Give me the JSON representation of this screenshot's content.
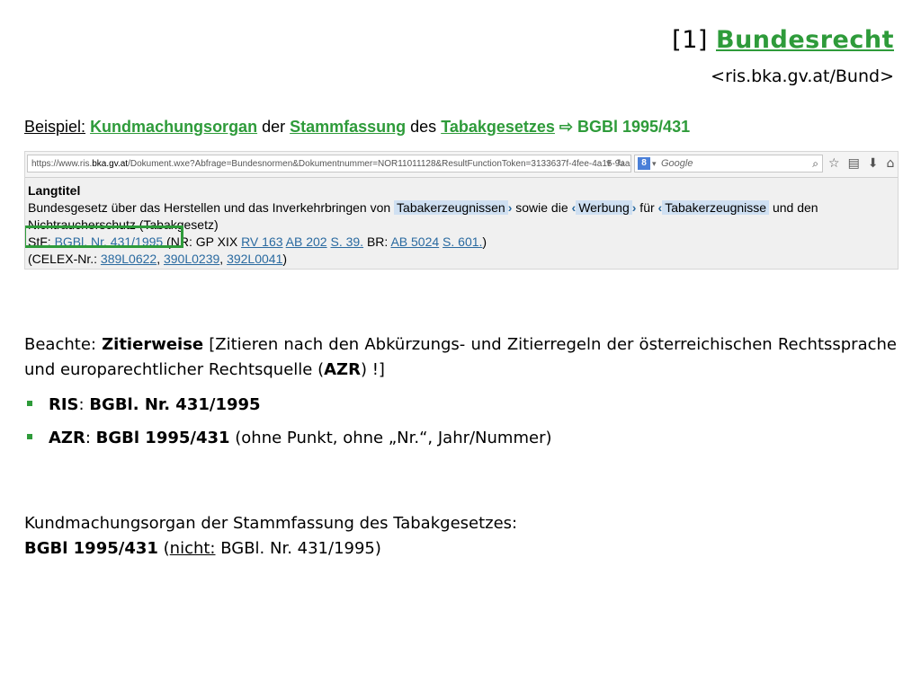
{
  "header": {
    "prefix": "[1] ",
    "title_link": "Bundesrecht",
    "subtitle": "<ris.bka.gv.at/Bund>"
  },
  "example": {
    "label": "Beispiel:",
    "w1": "Kundmachungsorgan",
    "w2": " der ",
    "w3": "Stammfassung",
    "w4": " des ",
    "w5": "Tabakgesetzes",
    "arrow": " ⇨ ",
    "citation": "BGBl 1995/431"
  },
  "browser": {
    "url_prefix": "https://www.ris.",
    "url_domain": "bka.gv.at",
    "url_rest": "/Dokument.wxe?Abfrage=Bundesnormen&Dokumentnummer=NOR11011128&ResultFunctionToken=3133637f-4fee-4a15-9aaa",
    "search_placeholder": "Google",
    "search_badge": "8",
    "content": {
      "heading": "Langtitel",
      "line1_a": "Bundesgesetz über das Herstellen und das Inverkehrbringen von ",
      "hl1": "Tabakerzeugnissen",
      "line1_b": " sowie die ",
      "hl2": "Werbung",
      "line1_c": " für ",
      "hl3": "Tabakerzeugnisse",
      "line1_d": " und den",
      "line2": "Nichtraucherschutz (Tabakgesetz)",
      "stf_label": "StF: ",
      "stf_link": "BGBl. Nr. 431/1995",
      "nr_text": " (NR: GP XIX ",
      "rv": "RV 163",
      "ab": "AB 202",
      "s1": "S. 39.",
      "br_text": " BR: ",
      "ab2": "AB 5024",
      "s2": "S. 601.",
      "close": ")",
      "celex_prefix": "(CELEX-Nr.: ",
      "c1": "389L0622",
      "c2": "390L0239",
      "c3": "392L0041",
      "celex_close": ")"
    }
  },
  "note": {
    "lead": "Beachte: ",
    "term": "Zitierweise",
    "text": " [Zitieren nach den Abkürzungs- und Zitierregeln der österreichischen Rechtssprache und europarechtlicher Rechtsquelle (",
    "azr": "AZR",
    "end": ") !]"
  },
  "bullets": [
    {
      "label": "RIS",
      "sep": ": ",
      "value": "BGBl. Nr. 431/1995",
      "extra": ""
    },
    {
      "label": "AZR",
      "sep": ": ",
      "value": "BGBl 1995/431",
      "extra": " (ohne Punkt, ohne „Nr.“, Jahr/Nummer)"
    }
  ],
  "conclusion": {
    "line1": "Kundmachungsorgan der Stammfassung des Tabakgesetzes:",
    "bold": "BGBl 1995/431",
    "mid": " (",
    "nicht": "nicht:",
    "rest": " BGBl. Nr. 431/1995)"
  },
  "colors": {
    "accent_green": "#2e9b3a",
    "link_blue": "#2a6aa0",
    "highlight": "#cfe0f2"
  }
}
